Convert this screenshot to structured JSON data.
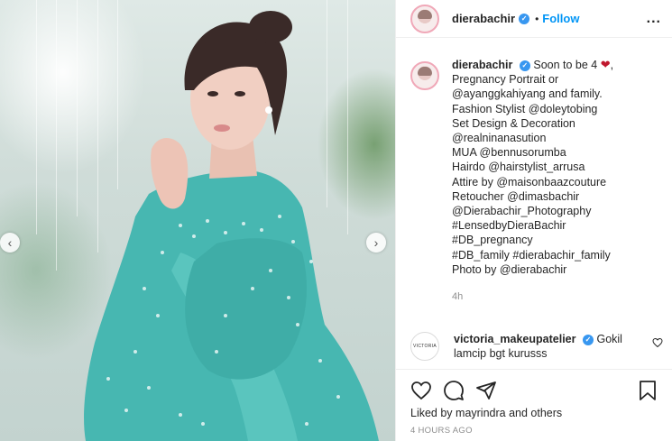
{
  "post": {
    "username": "dierabachir",
    "dot": "•",
    "follow_label": "Follow",
    "more_label": "...",
    "verified_mark": "✓",
    "caption_lines": [
      "Soon to be 4",
      "Pregnancy Portrait or",
      "@ayanggkahiyang and family.",
      "Fashion Stylist @doleytobing",
      "Set Design & Decoration",
      "@realninanasution",
      "MUA @bennusorumba",
      "Hairdo @hairstylist_arrusa",
      "Attire by @maisonbaazcouture",
      "Retoucher @dimasbachir",
      "@Dierabachir_Photography",
      "#LensedbyDieraBachir",
      "#DB_pregnancy",
      "#DB_family #dierabachir_family",
      "Photo by @dierabachir"
    ],
    "caption_emoji": "❤",
    "caption_emoji_suffix": ",",
    "caption_time": "4h",
    "comment": {
      "username": "victoria_makeupatelier",
      "text_first": "Gokil",
      "text_second": "lamcip bgt kurusss",
      "avatar_text": "VICTORIA"
    },
    "liked_by": "Liked by mayrindra and others",
    "timestamp": "4 HOURS AGO"
  },
  "carousel": {
    "prev_glyph": "‹",
    "next_glyph": "›"
  },
  "icons": {
    "like": "heart-icon",
    "comment": "comment-icon",
    "share": "share-icon",
    "save": "bookmark-icon",
    "comment_like": "heart-icon"
  },
  "colors": {
    "accent_blue": "#0095f6",
    "verified_blue": "#3897f0",
    "muted_text": "#8e8e8e",
    "dress_teal": "#46b6b0"
  }
}
